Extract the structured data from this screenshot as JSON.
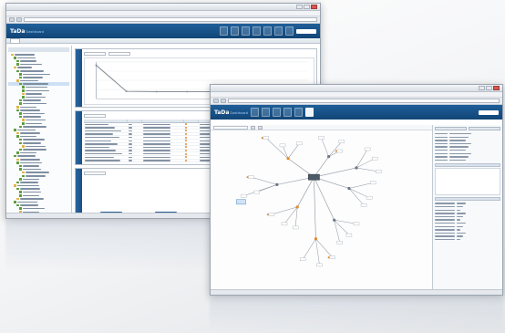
{
  "colors": {
    "header_blue": "#1a5489",
    "chart_line": "#8a8f96",
    "node_fill": "#ffffff",
    "node_orange": "#e08b2f",
    "link_gray": "#8e96a0",
    "tree_green": "#5d9b3c",
    "selection": "#cde0f4"
  },
  "back_window": {
    "logo_main": "TaDa",
    "logo_sub": "Dashboard",
    "toolbar_icons": [
      "server-icon",
      "chart-icon",
      "gear-icon",
      "monitor-icon",
      "database-icon",
      "user-icon",
      "home-icon"
    ],
    "chart": {
      "type": "line",
      "series": [
        {
          "values": [
            100,
            22,
            21,
            21,
            21,
            21,
            21,
            22
          ]
        }
      ],
      "ylim": [
        0,
        110
      ]
    }
  },
  "front_window": {
    "logo_main": "TaDa",
    "logo_sub": "Dashboard",
    "toolbar_icons": [
      "server-icon",
      "chart-icon",
      "gear-icon",
      "monitor-icon",
      "database-icon",
      "user-icon"
    ],
    "graph_icons": [
      "network-node-icon",
      "network-hub-icon",
      "network-link-icon"
    ]
  }
}
